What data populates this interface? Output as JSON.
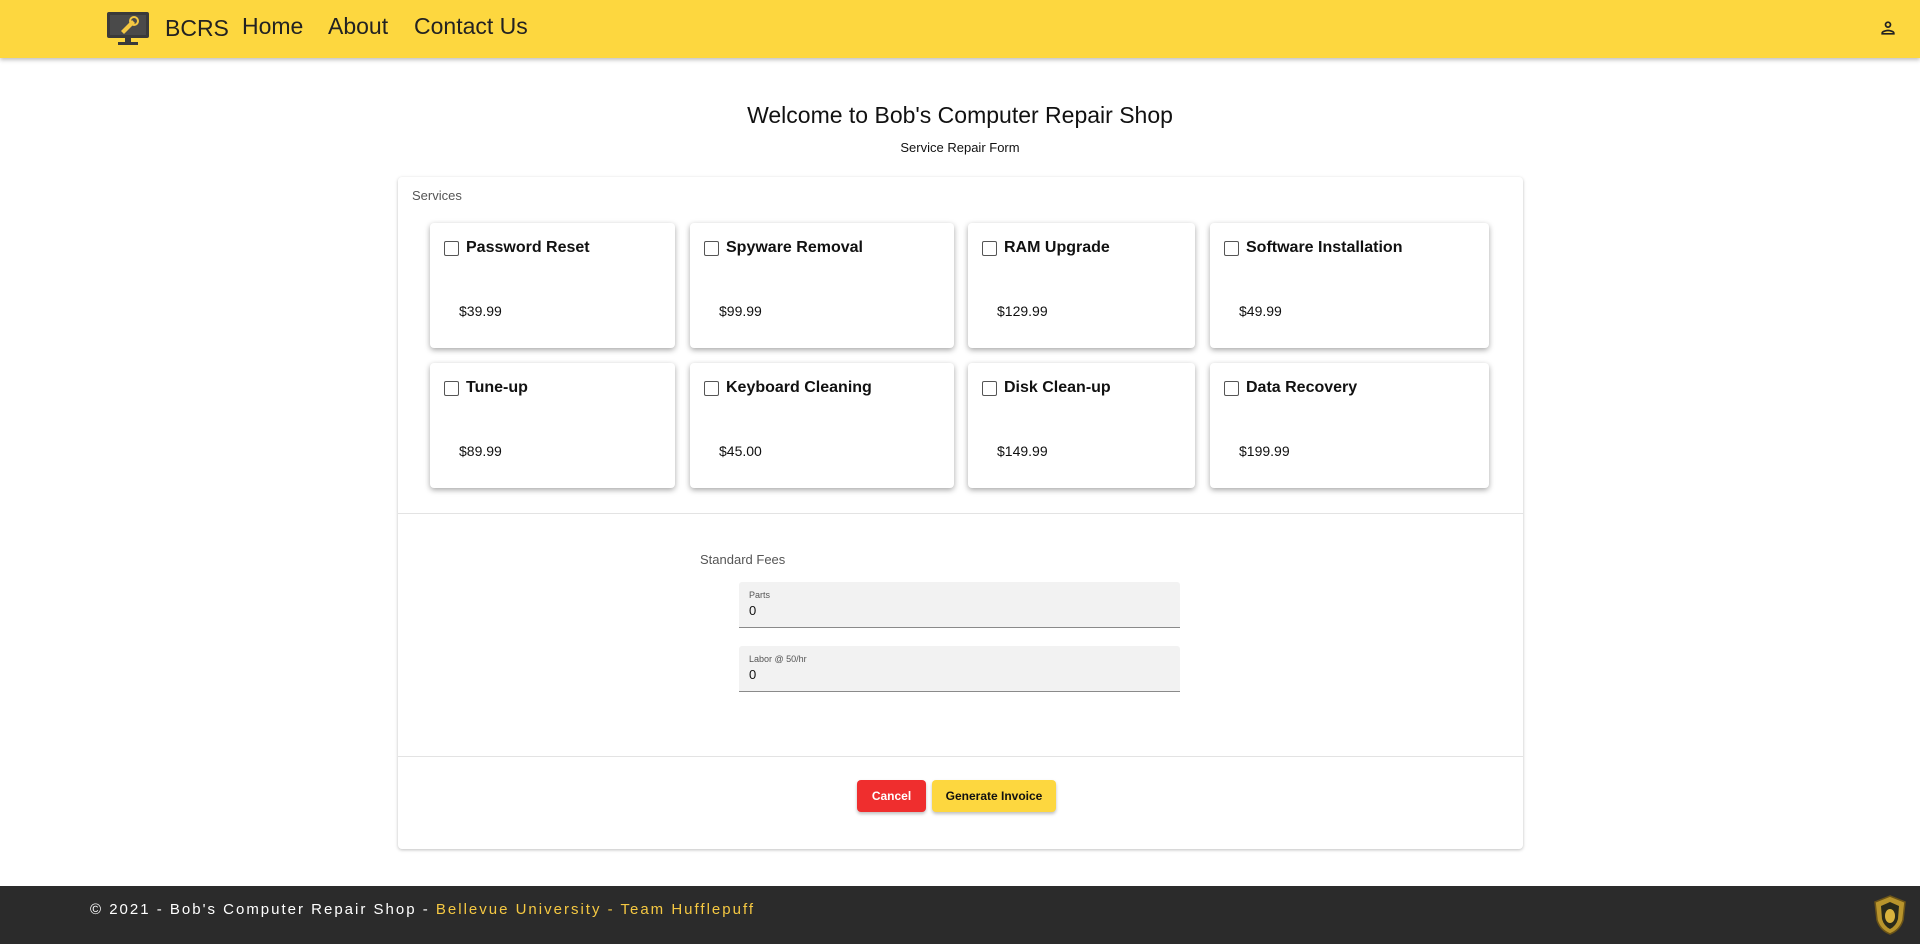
{
  "header": {
    "brand": "BCRS",
    "nav": [
      {
        "label": "Home"
      },
      {
        "label": "About"
      },
      {
        "label": "Contact Us"
      }
    ],
    "logo_icon": "computer-wrench-icon",
    "user_icon": "person-icon"
  },
  "page": {
    "title": "Welcome to Bob's Computer Repair Shop",
    "subtitle": "Service Repair Form"
  },
  "services": {
    "label": "Services",
    "items": [
      {
        "name": "Password Reset",
        "price": "$39.99"
      },
      {
        "name": "Spyware Removal",
        "price": "$99.99"
      },
      {
        "name": "RAM Upgrade",
        "price": "$129.99"
      },
      {
        "name": "Software Installation",
        "price": "$49.99"
      },
      {
        "name": "Tune-up",
        "price": "$89.99"
      },
      {
        "name": "Keyboard Cleaning",
        "price": "$45.00"
      },
      {
        "name": "Disk Clean-up",
        "price": "$149.99"
      },
      {
        "name": "Data Recovery",
        "price": "$199.99"
      }
    ]
  },
  "fees": {
    "label": "Standard Fees",
    "parts": {
      "label": "Parts",
      "value": "0"
    },
    "labor": {
      "label": "Labor @ 50/hr",
      "value": "0"
    }
  },
  "actions": {
    "cancel": "Cancel",
    "invoice": "Generate Invoice"
  },
  "footer": {
    "text": "© 2021 - Bob's Computer Repair Shop - ",
    "highlight": "Bellevue University - Team Hufflepuff",
    "crest_icon": "hufflepuff-crest-icon"
  },
  "colors": {
    "header_bg": "#fdd73f",
    "cancel_bg": "#ef2e2e",
    "invoice_bg": "#fdd73f",
    "footer_bg": "#2b2b2b",
    "footer_highlight": "#f5c842"
  }
}
